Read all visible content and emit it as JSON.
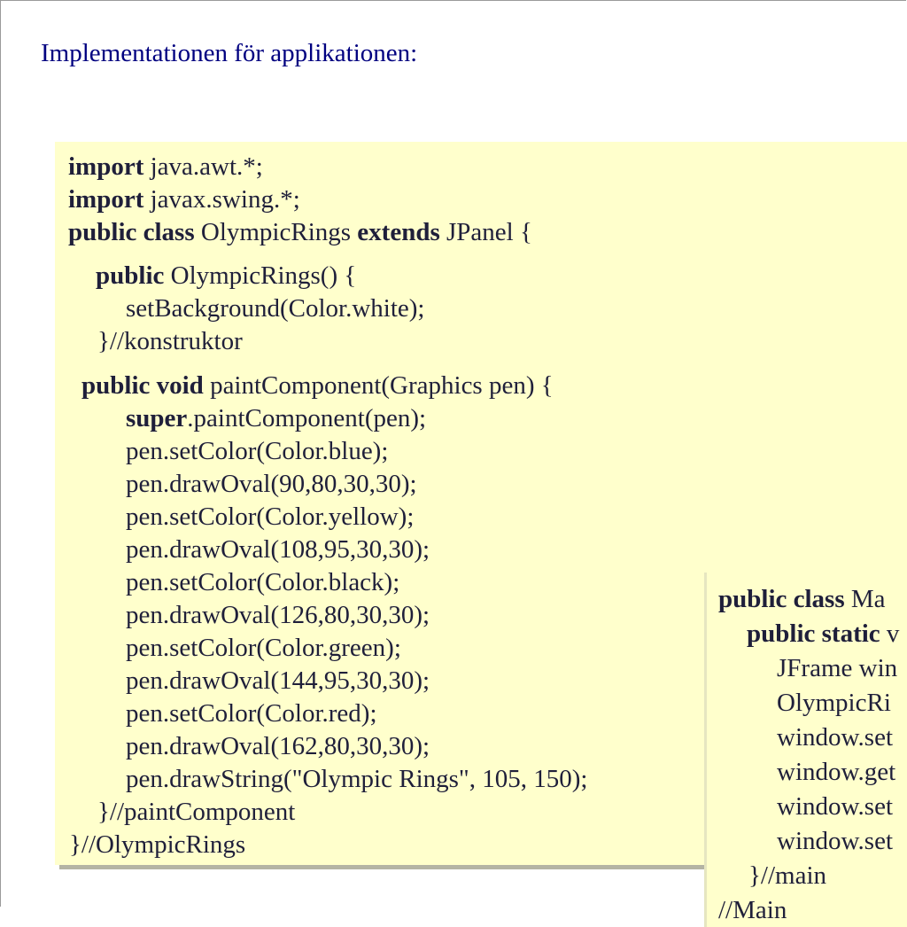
{
  "heading": "Implementationen för applikationen:",
  "code1": [
    [
      {
        "t": "import",
        "b": true
      },
      {
        "t": " java.awt.*;"
      }
    ],
    [
      {
        "t": "import",
        "b": true
      },
      {
        "t": " javax.swing.*;"
      }
    ],
    [
      {
        "t": "public class",
        "b": true
      },
      {
        "t": " OlympicRings "
      },
      {
        "t": "extends",
        "b": true
      },
      {
        "t": " JPanel {"
      }
    ],
    [
      {
        "t": "public",
        "b": true
      },
      {
        "t": " OlympicRings() {"
      }
    ],
    [
      {
        "t": "setBackground(Color.white);"
      }
    ],
    [
      {
        "t": "}//konstruktor"
      }
    ],
    [
      {
        "t": "public void",
        "b": true
      },
      {
        "t": " paintComponent(Graphics pen) {"
      }
    ],
    [
      {
        "t": "super",
        "b": true
      },
      {
        "t": ".paintComponent(pen);"
      }
    ],
    [
      {
        "t": "pen.setColor(Color.blue);"
      }
    ],
    [
      {
        "t": "pen.drawOval(90,80,30,30);"
      }
    ],
    [
      {
        "t": "pen.setColor(Color.yellow);"
      }
    ],
    [
      {
        "t": "pen.drawOval(108,95,30,30);"
      }
    ],
    [
      {
        "t": "pen.setColor(Color.black);"
      }
    ],
    [
      {
        "t": "pen.drawOval(126,80,30,30);"
      }
    ],
    [
      {
        "t": "pen.setColor(Color.green);"
      }
    ],
    [
      {
        "t": "pen.drawOval(144,95,30,30);"
      }
    ],
    [
      {
        "t": "pen.setColor(Color.red);"
      }
    ],
    [
      {
        "t": "pen.drawOval(162,80,30,30);"
      }
    ],
    [
      {
        "t": "pen.drawString(\"Olympic Rings\", 105, 150);"
      }
    ],
    [
      {
        "t": "}//paintComponent"
      }
    ],
    [
      {
        "t": "}//OlympicRings"
      }
    ]
  ],
  "code2": [
    [
      {
        "t": "public class",
        "b": true
      },
      {
        "t": " Ma"
      }
    ],
    [
      {
        "t": "public static",
        "b": true
      },
      {
        "t": " v"
      }
    ],
    [
      {
        "t": "JFrame win"
      }
    ],
    [
      {
        "t": "OlympicRi"
      }
    ],
    [
      {
        "t": "window.set"
      }
    ],
    [
      {
        "t": "window.get"
      }
    ],
    [
      {
        "t": "window.set"
      }
    ],
    [
      {
        "t": "window.set"
      }
    ],
    [
      {
        "t": "}//main"
      }
    ],
    [
      {
        "t": "//Main"
      }
    ]
  ],
  "colors": {
    "heading": "#000080",
    "code_background": "#ffffcc",
    "code_text": "#1f1f3a"
  }
}
